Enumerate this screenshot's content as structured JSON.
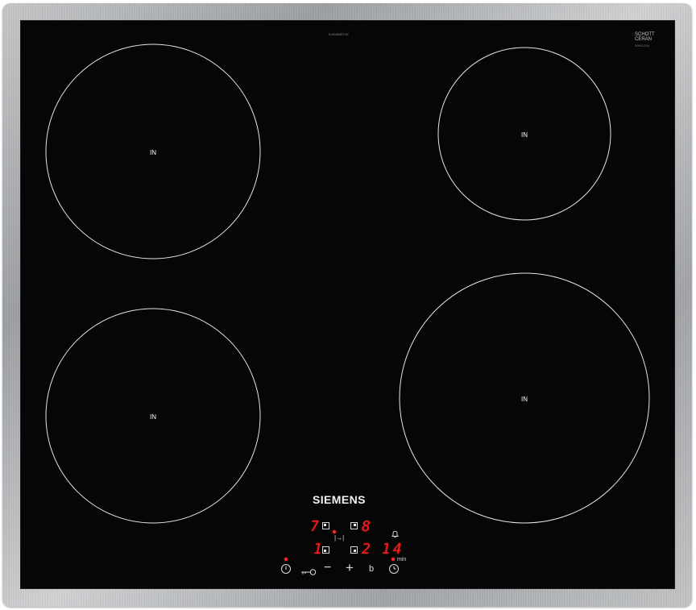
{
  "appliance": {
    "brand": "SIEMENS",
    "model_label": "EU645BEF1E",
    "glass_brand_line1": "SCHOTT",
    "glass_brand_line2": "CERAN",
    "glass_sub": "00001234",
    "zone_label": "IN",
    "colors": {
      "glass": "#060606",
      "frame": "#b8babc",
      "display": "#ff1d1d",
      "ring": "#e6e6e6"
    }
  },
  "zones": {
    "front_left_level": "1",
    "rear_left_level": "7",
    "rear_right_level": "8",
    "front_right_level": "2"
  },
  "timer": {
    "value": "14",
    "unit": "min"
  },
  "controls": {
    "power_icon": "power-icon",
    "lock_icon": "key-lock-icon",
    "minus": "−",
    "plus": "+",
    "boost": "b",
    "timer_icon": "clock-icon",
    "bell_icon": "bell-icon",
    "multi_zone_icon": "|→|"
  }
}
